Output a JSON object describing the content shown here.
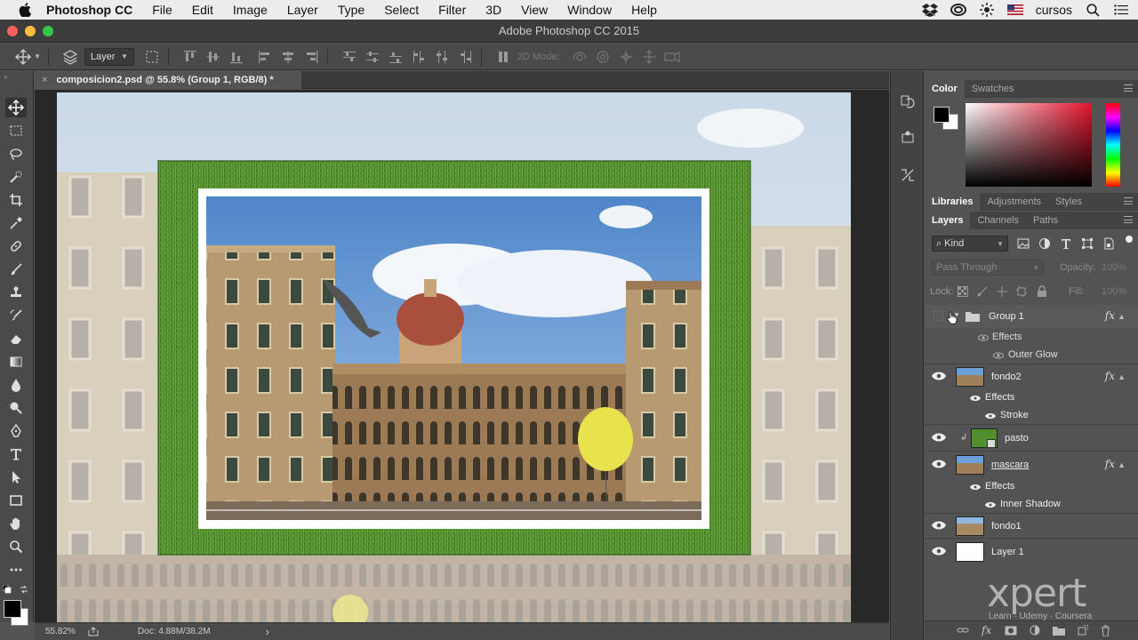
{
  "menubar": {
    "app_name": "Photoshop CC",
    "items": [
      "File",
      "Edit",
      "Image",
      "Layer",
      "Type",
      "Select",
      "Filter",
      "3D",
      "View",
      "Window",
      "Help"
    ],
    "user": "cursos"
  },
  "window": {
    "title": "Adobe Photoshop CC 2015"
  },
  "options": {
    "auto_select_value": "Layer",
    "mode_3d_label": "3D Mode:"
  },
  "document": {
    "tab_title": "composicion2.psd @ 55.8% (Group 1, RGB/8) *",
    "close_glyph": "×"
  },
  "status": {
    "zoom": "55.82%",
    "doc_info": "Doc: 4.88M/38.2M",
    "arrow": "›"
  },
  "color_panel": {
    "tabs": [
      "Color",
      "Swatches"
    ]
  },
  "libraries_panel": {
    "tabs": [
      "Libraries",
      "Adjustments",
      "Styles"
    ]
  },
  "layers_panel": {
    "tabs": [
      "Layers",
      "Channels",
      "Paths"
    ],
    "filter_kind": "Kind",
    "blend_mode": "Pass Through",
    "opacity_label": "Opacity:",
    "opacity_value": "100%",
    "lock_label": "Lock:",
    "fill_label": "Fill:",
    "fill_value": "100%",
    "fx_label": "fx",
    "layers": [
      {
        "name": "Group 1",
        "type": "group",
        "visible": false,
        "has_fx": true
      },
      {
        "name": "Effects",
        "type": "effects",
        "indent": 1
      },
      {
        "name": "Outer Glow",
        "type": "effect",
        "indent": 2
      },
      {
        "name": "fondo2",
        "type": "image",
        "visible": true,
        "has_fx": true
      },
      {
        "name": "Effects",
        "type": "effects",
        "indent": 1
      },
      {
        "name": "Stroke",
        "type": "effect",
        "indent": 2
      },
      {
        "name": "pasto",
        "type": "clipped",
        "visible": true
      },
      {
        "name": "mascara",
        "type": "image",
        "visible": true,
        "has_fx": true
      },
      {
        "name": "Effects",
        "type": "effects",
        "indent": 1
      },
      {
        "name": "Inner Shadow",
        "type": "effect",
        "indent": 2
      },
      {
        "name": "fondo1",
        "type": "image",
        "visible": true
      },
      {
        "name": "Layer 1",
        "type": "white",
        "visible": true
      }
    ]
  },
  "watermark": {
    "text": "xpert",
    "sub": "Learn · Udemy · Coursera"
  },
  "colors": {
    "foreground": "#000000",
    "background": "#ffffff",
    "grass": "#4f8f2d",
    "sky": "#7fb3e3"
  }
}
